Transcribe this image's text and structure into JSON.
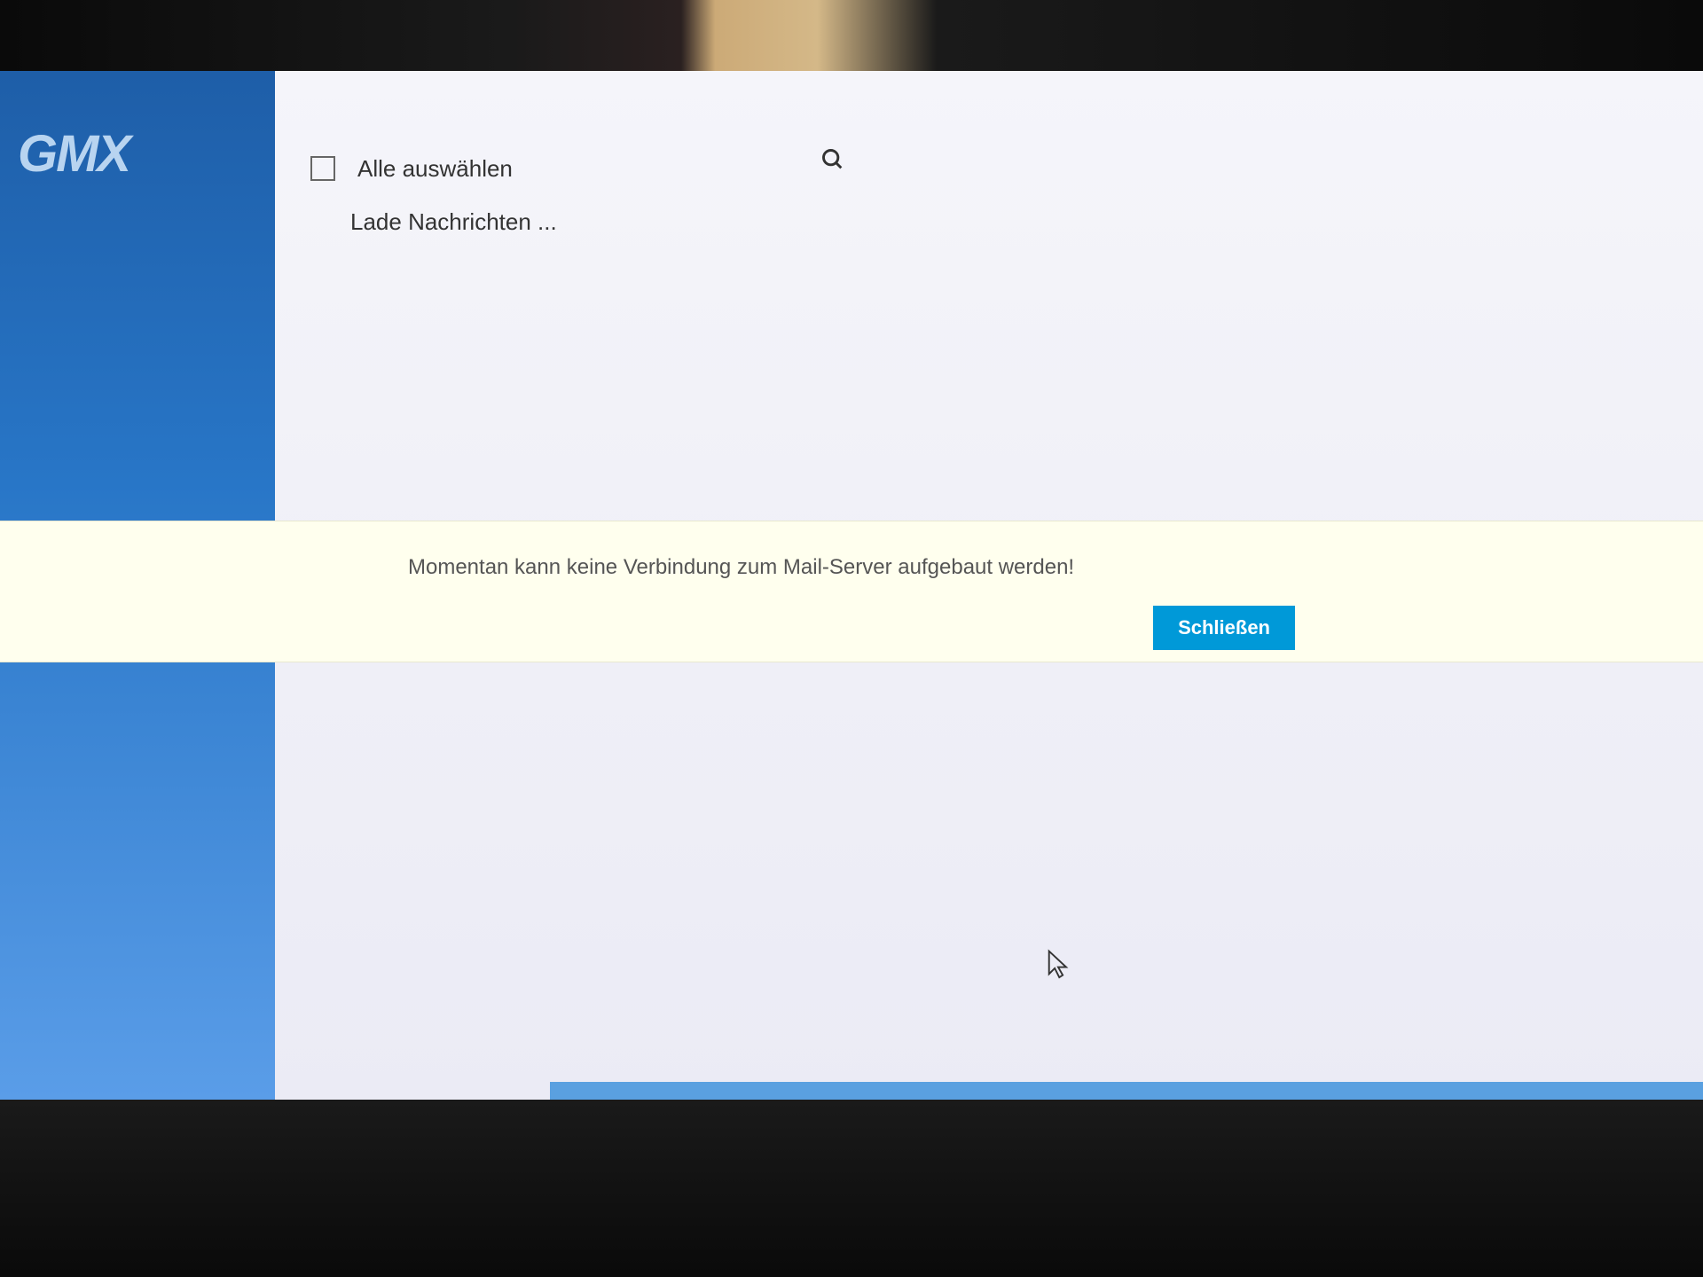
{
  "sidebar": {
    "logo_text": "GMX"
  },
  "toolbar": {
    "select_all_label": "Alle auswählen"
  },
  "main": {
    "loading_text": "Lade Nachrichten ..."
  },
  "notification": {
    "message": "Momentan kann keine Verbindung zum Mail-Server aufgebaut werden!",
    "close_label": "Schließen"
  }
}
